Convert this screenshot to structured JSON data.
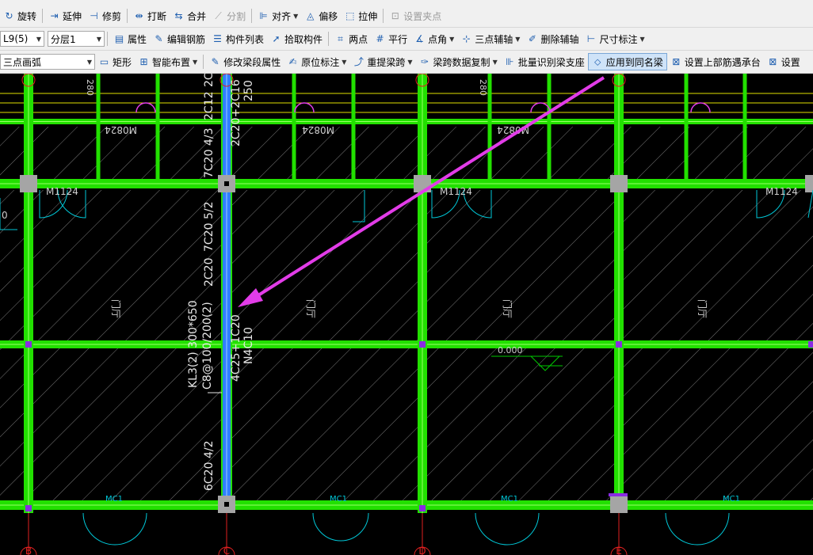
{
  "toolbar1": {
    "items": [
      {
        "label": "旋转",
        "icon": "rotate-icon",
        "glyph": "↻"
      },
      {
        "label": "延伸",
        "icon": "extend-icon",
        "glyph": "⇥"
      },
      {
        "label": "修剪",
        "icon": "trim-icon",
        "glyph": "⊣"
      },
      {
        "label": "打断",
        "icon": "break-icon",
        "glyph": "⇹"
      },
      {
        "label": "合并",
        "icon": "merge-icon",
        "glyph": "⇆"
      },
      {
        "label": "分割",
        "icon": "split-icon",
        "glyph": "⟋",
        "disabled": true
      },
      {
        "label": "对齐",
        "icon": "align-icon",
        "glyph": "⊫",
        "dropdown": true
      },
      {
        "label": "偏移",
        "icon": "offset-icon",
        "glyph": "◬"
      },
      {
        "label": "拉伸",
        "icon": "stretch-icon",
        "glyph": "⬚"
      },
      {
        "label": "设置夹点",
        "icon": "grip-icon",
        "glyph": "⊡",
        "disabled": true
      }
    ]
  },
  "toolbar2": {
    "element_select": "L9(5)",
    "floor_select": "分层1",
    "items": [
      {
        "label": "属性",
        "icon": "properties-icon",
        "glyph": "▤"
      },
      {
        "label": "编辑钢筋",
        "icon": "edit-rebar-icon",
        "glyph": "✎"
      },
      {
        "label": "构件列表",
        "icon": "component-list-icon",
        "glyph": "☰"
      },
      {
        "label": "拾取构件",
        "icon": "pick-component-icon",
        "glyph": "➚"
      },
      {
        "label": "两点",
        "icon": "two-points-icon",
        "glyph": "⌗"
      },
      {
        "label": "平行",
        "icon": "parallel-icon",
        "glyph": "#"
      },
      {
        "label": "点角",
        "icon": "point-angle-icon",
        "glyph": "∡",
        "dropdown": true
      },
      {
        "label": "三点辅轴",
        "icon": "three-point-axis-icon",
        "glyph": "⊹",
        "dropdown": true
      },
      {
        "label": "删除辅轴",
        "icon": "delete-axis-icon",
        "glyph": "✐"
      },
      {
        "label": "尺寸标注",
        "icon": "dimension-icon",
        "glyph": "⊢",
        "dropdown": true
      }
    ]
  },
  "toolbar3": {
    "draw_select": "三点画弧",
    "items": [
      {
        "label": "矩形",
        "icon": "rectangle-icon",
        "glyph": "▭"
      },
      {
        "label": "智能布置",
        "icon": "smart-layout-icon",
        "glyph": "⊞",
        "dropdown": true
      },
      {
        "label": "修改梁段属性",
        "icon": "modify-beam-segment-icon",
        "glyph": "✎"
      },
      {
        "label": "原位标注",
        "icon": "in-situ-annotation-icon",
        "glyph": "✍",
        "dropdown": true
      },
      {
        "label": "重提梁跨",
        "icon": "re-extract-span-icon",
        "glyph": "⤴",
        "dropdown": true
      },
      {
        "label": "梁跨数据复制",
        "icon": "span-data-copy-icon",
        "glyph": "✑",
        "dropdown": true
      },
      {
        "label": "批量识别梁支座",
        "icon": "batch-identify-support-icon",
        "glyph": "⊪"
      },
      {
        "label": "应用到同名梁",
        "icon": "apply-same-name-beam-icon",
        "glyph": "⬦",
        "active": true
      },
      {
        "label": "设置上部筋遇承台",
        "icon": "top-rebar-pile-cap-icon",
        "glyph": "⊠"
      },
      {
        "label": "设置",
        "icon": "settings-icon",
        "glyph": "⊠"
      }
    ]
  },
  "drawing": {
    "axis_labels": [
      "B",
      "C",
      "D",
      "E"
    ],
    "doors": {
      "m1124": [
        "M1124",
        "M1124",
        "M1124"
      ],
      "m0824": [
        "M0824",
        "M0824",
        "M0824"
      ],
      "mc1": [
        "MC1",
        "MC1",
        "MC1",
        "MC1"
      ]
    },
    "room_labels": [
      "门厅",
      "门厅",
      "门厅",
      "门厅"
    ],
    "left_stub": "0",
    "elevation": "0.000",
    "dims_280": [
      "280",
      "280"
    ],
    "beam_annotations": {
      "top_left": "2C12",
      "top_right": "2C20+2C16",
      "top_right2": "250",
      "top_text_1": "7C20 4/3",
      "top_text_2": "2C20",
      "mid_1": "7C20 5/2",
      "mid_2": "2C20",
      "name": "KL3(2) 300*650",
      "stirrup": "C8@100/200(2)",
      "mid_right_1": "4C25+1C20",
      "mid_right_2": "N4C10",
      "bottom": "6C20 4/2"
    },
    "colors": {
      "beam_green": "#22e000",
      "selected_beam": "#2f7fff",
      "annotation_arrow": "#e23ce8",
      "hatch": "#7a7a7a",
      "column": "#a5a5a5",
      "door_cyan": "#00c8d8",
      "axis_red": "#e02020",
      "yellow": "#e0e000"
    }
  }
}
